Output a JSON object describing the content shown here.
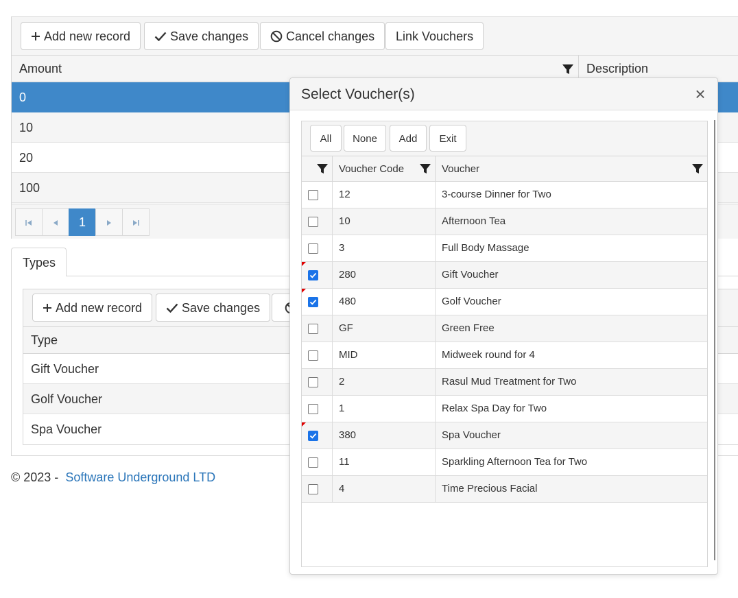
{
  "toolbar": {
    "add_label": "Add new record",
    "save_label": "Save changes",
    "cancel_label": "Cancel changes",
    "link_label": "Link Vouchers"
  },
  "amount_grid": {
    "columns": [
      "Amount",
      "Description"
    ],
    "rows": [
      "0",
      "10",
      "20",
      "100"
    ],
    "selected_index": 0
  },
  "pager": {
    "current_page": "1"
  },
  "types_tab": {
    "label": "Types"
  },
  "types_toolbar": {
    "add_label": "Add new record",
    "save_label": "Save changes"
  },
  "types_grid": {
    "column": "Type",
    "rows": [
      "Gift Voucher",
      "Golf Voucher",
      "Spa Voucher"
    ]
  },
  "footer": {
    "copyright": "© 2023 -",
    "company": "Software Underground LTD"
  },
  "modal": {
    "title": "Select Voucher(s)",
    "close": "×",
    "buttons": {
      "all": "All",
      "none": "None",
      "add": "Add",
      "exit": "Exit"
    },
    "columns": {
      "code": "Voucher Code",
      "voucher": "Voucher"
    },
    "rows": [
      {
        "code": "12",
        "voucher": "3-course Dinner for Two",
        "checked": false,
        "dirty": false
      },
      {
        "code": "10",
        "voucher": "Afternoon Tea",
        "checked": false,
        "dirty": false
      },
      {
        "code": "3",
        "voucher": "Full Body Massage",
        "checked": false,
        "dirty": false
      },
      {
        "code": "280",
        "voucher": "Gift Voucher",
        "checked": true,
        "dirty": true
      },
      {
        "code": "480",
        "voucher": "Golf Voucher",
        "checked": true,
        "dirty": true
      },
      {
        "code": "GF",
        "voucher": "Green Free",
        "checked": false,
        "dirty": false
      },
      {
        "code": "MID",
        "voucher": "Midweek round for 4",
        "checked": false,
        "dirty": false
      },
      {
        "code": "2",
        "voucher": "Rasul Mud Treatment for Two",
        "checked": false,
        "dirty": false
      },
      {
        "code": "1",
        "voucher": "Relax Spa Day for Two",
        "checked": false,
        "dirty": false
      },
      {
        "code": "380",
        "voucher": "Spa Voucher",
        "checked": true,
        "dirty": true
      },
      {
        "code": "11",
        "voucher": "Sparkling Afternoon Tea for Two",
        "checked": false,
        "dirty": false
      },
      {
        "code": "4",
        "voucher": "Time Precious Facial",
        "checked": false,
        "dirty": false
      }
    ]
  },
  "colors": {
    "selected_row": "#3f88c9",
    "link": "#2a75b9",
    "checkbox": "#1a73e8",
    "dirty_marker": "#e00000"
  }
}
